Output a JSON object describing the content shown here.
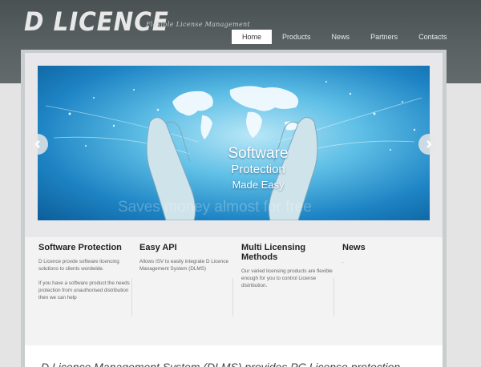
{
  "brand": {
    "logo": "D LICENCE",
    "tagline": "Flexible License Management"
  },
  "nav": {
    "items": [
      "Home",
      "Products",
      "News",
      "Partners",
      "Contacts"
    ],
    "active": "Home"
  },
  "slider": {
    "line1": "Software",
    "line2": "Protection",
    "line3": "Made Easy",
    "ghost_text": "Saves money almost for free"
  },
  "features": [
    {
      "title": "Software Protection",
      "paragraphs": [
        "D Licence provde software licencing solutions to clients wordwide.",
        "If you have a software product the needs protection from unauthorised distribution then we can help"
      ]
    },
    {
      "title": "Easy API",
      "paragraphs": [
        "Allows ISV to easily integrate D Licence Management System (DLMS)"
      ]
    },
    {
      "title": "Multi Licensing Methods",
      "paragraphs": [
        "Our varied licensing products are flexible enough for you to control License distribution."
      ]
    },
    {
      "title": "News",
      "paragraphs": [
        "."
      ]
    }
  ],
  "bottom": {
    "text": "D Licence Management System (DLMS) provides PC License protection"
  },
  "colors": {
    "header": "#5a6264",
    "page_bg": "#e4e4e4",
    "panel_bg": "#f3f3f4",
    "slide_blue": "#1e84c4"
  }
}
